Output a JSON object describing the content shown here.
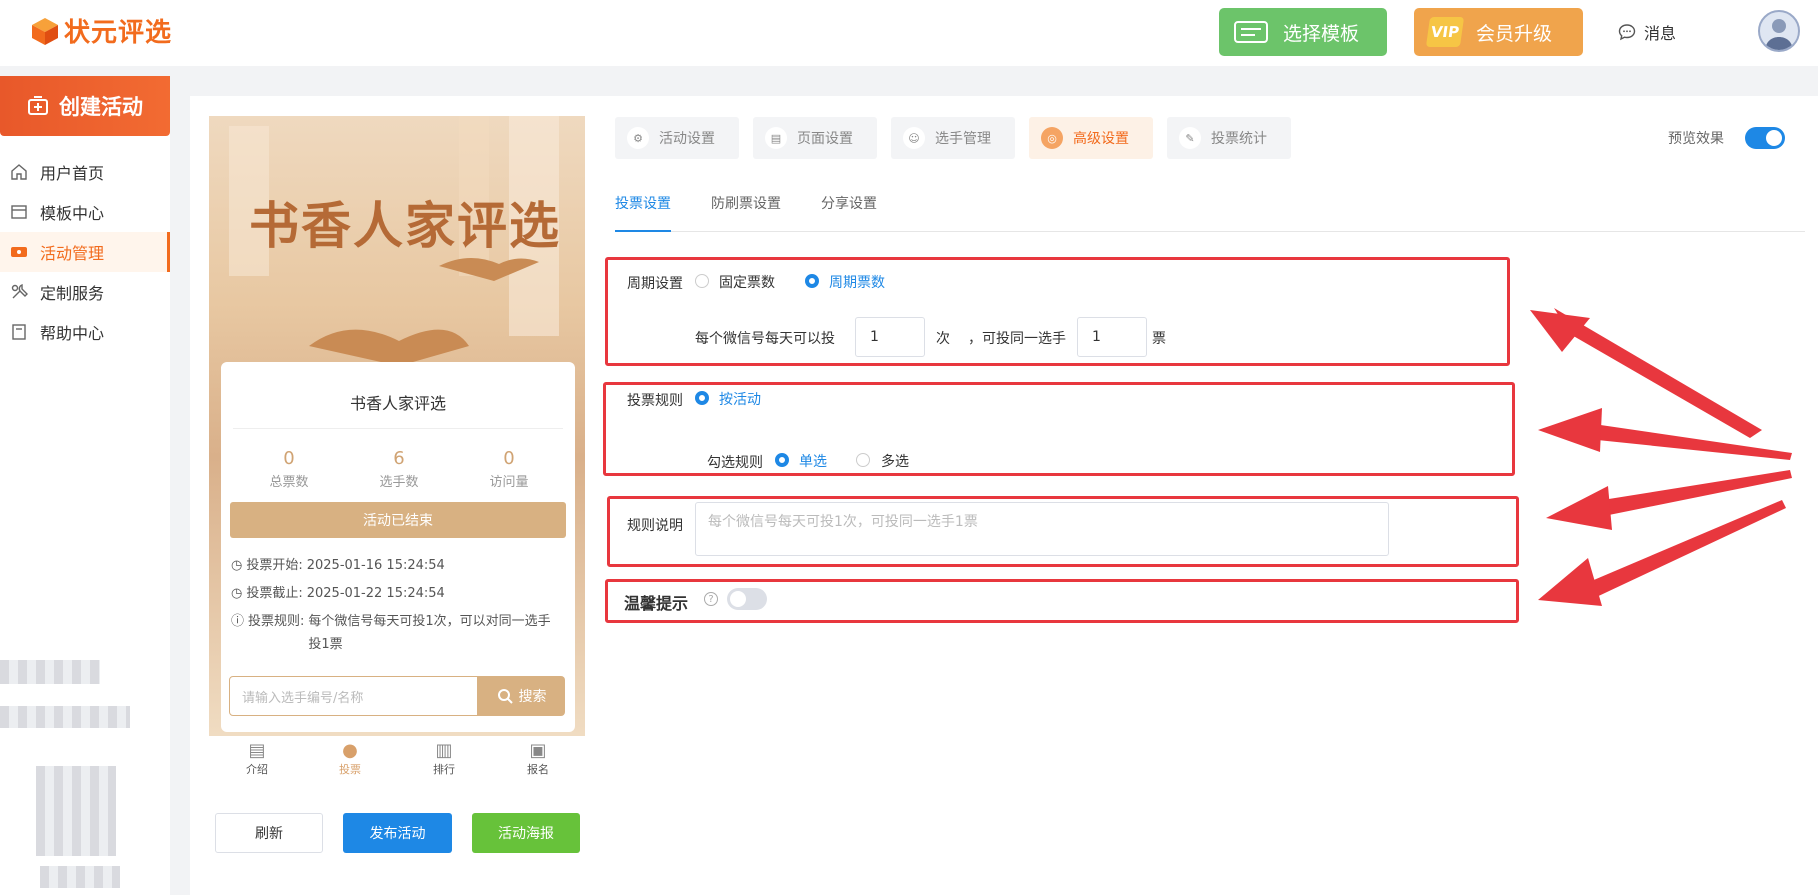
{
  "header": {
    "logo_text": "状元评选",
    "template_button": "选择模板",
    "vip_badge": "VIP",
    "upgrade_button": "会员升级",
    "message_label": "消息"
  },
  "sidebar": {
    "create_button": "创建活动",
    "items": [
      {
        "label": "用户首页",
        "icon": "home-icon",
        "active": false
      },
      {
        "label": "模板中心",
        "icon": "folder-icon",
        "active": false
      },
      {
        "label": "活动管理",
        "icon": "ticket-icon",
        "active": true
      },
      {
        "label": "定制服务",
        "icon": "tools-icon",
        "active": false
      },
      {
        "label": "帮助中心",
        "icon": "book-icon",
        "active": false
      }
    ]
  },
  "preview": {
    "banner_title": "书香人家评选",
    "card_title": "书香人家评选",
    "stats": [
      {
        "value": "0",
        "label": "总票数"
      },
      {
        "value": "6",
        "label": "选手数"
      },
      {
        "value": "0",
        "label": "访问量"
      }
    ],
    "status_button": "活动已结束",
    "vote_start_label": "投票开始:",
    "vote_start": "2025-01-16 15:24:54",
    "vote_end_label": "投票截止:",
    "vote_end": "2025-01-22 15:24:54",
    "rule_label": "投票规则:",
    "rule_text": "每个微信号每天可投1次，可以对同一选手投1票",
    "search_placeholder": "请输入选手编号/名称",
    "search_button": "搜索",
    "bottom_tabs": [
      "介绍",
      "投票",
      "排行",
      "报名"
    ]
  },
  "actions": {
    "refresh": "刷新",
    "publish": "发布活动",
    "poster": "活动海报"
  },
  "steps": [
    "活动设置",
    "页面设置",
    "选手管理",
    "高级设置",
    "投票统计"
  ],
  "preview_toggle_label": "预览效果",
  "subtabs": [
    "投票设置",
    "防刷票设置",
    "分享设置"
  ],
  "settings": {
    "cycle_label": "周期设置",
    "cycle_options": [
      "固定票数",
      "周期票数"
    ],
    "per_day_label": "每个微信号每天可以投",
    "per_day_value": "1",
    "times_unit": "次",
    "same_player_label": "，可投同一选手",
    "same_player_value": "1",
    "votes_unit": "票",
    "rule_label": "投票规则",
    "rule_option": "按活动",
    "select_rule_label": "勾选规则",
    "select_options": [
      "单选",
      "多选"
    ],
    "desc_label": "规则说明",
    "desc_placeholder": "每个微信号每天可投1次，可投同一选手1票",
    "tip_label": "温馨提示",
    "help_mark": "?"
  },
  "colors": {
    "brand": "#f26b1d",
    "accent_blue": "#1e88e5",
    "highlight_red": "#e8373e",
    "gold": "#d8b182"
  }
}
